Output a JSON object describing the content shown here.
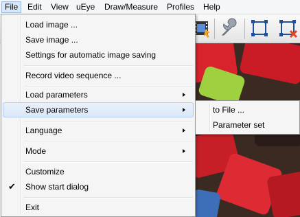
{
  "menubar": {
    "items": [
      "File",
      "Edit",
      "View",
      "uEye",
      "Draw/Measure",
      "Profiles",
      "Help"
    ]
  },
  "toolbar": {
    "icons": [
      "filmstrip-icon",
      "wrench-icon",
      "roi-frame-icon",
      "roi-delete-icon"
    ]
  },
  "file_menu": {
    "load_image": "Load image ...",
    "save_image": "Save image ...",
    "auto_save": "Settings for automatic image saving",
    "record_video": "Record video sequence ...",
    "load_parameters": "Load parameters",
    "save_parameters": "Save parameters",
    "language": "Language",
    "mode": "Mode",
    "customize": "Customize",
    "show_start_dialog": "Show start dialog",
    "show_start_dialog_checked": true,
    "exit": "Exit"
  },
  "save_parameters_submenu": {
    "to_file": "to File ...",
    "parameter_set": "Parameter set"
  },
  "colors": {
    "highlight": "#dbe8f8",
    "highlight_border": "#aecbee",
    "cube_red": "#d8222c",
    "cube_green": "#9ed040"
  }
}
